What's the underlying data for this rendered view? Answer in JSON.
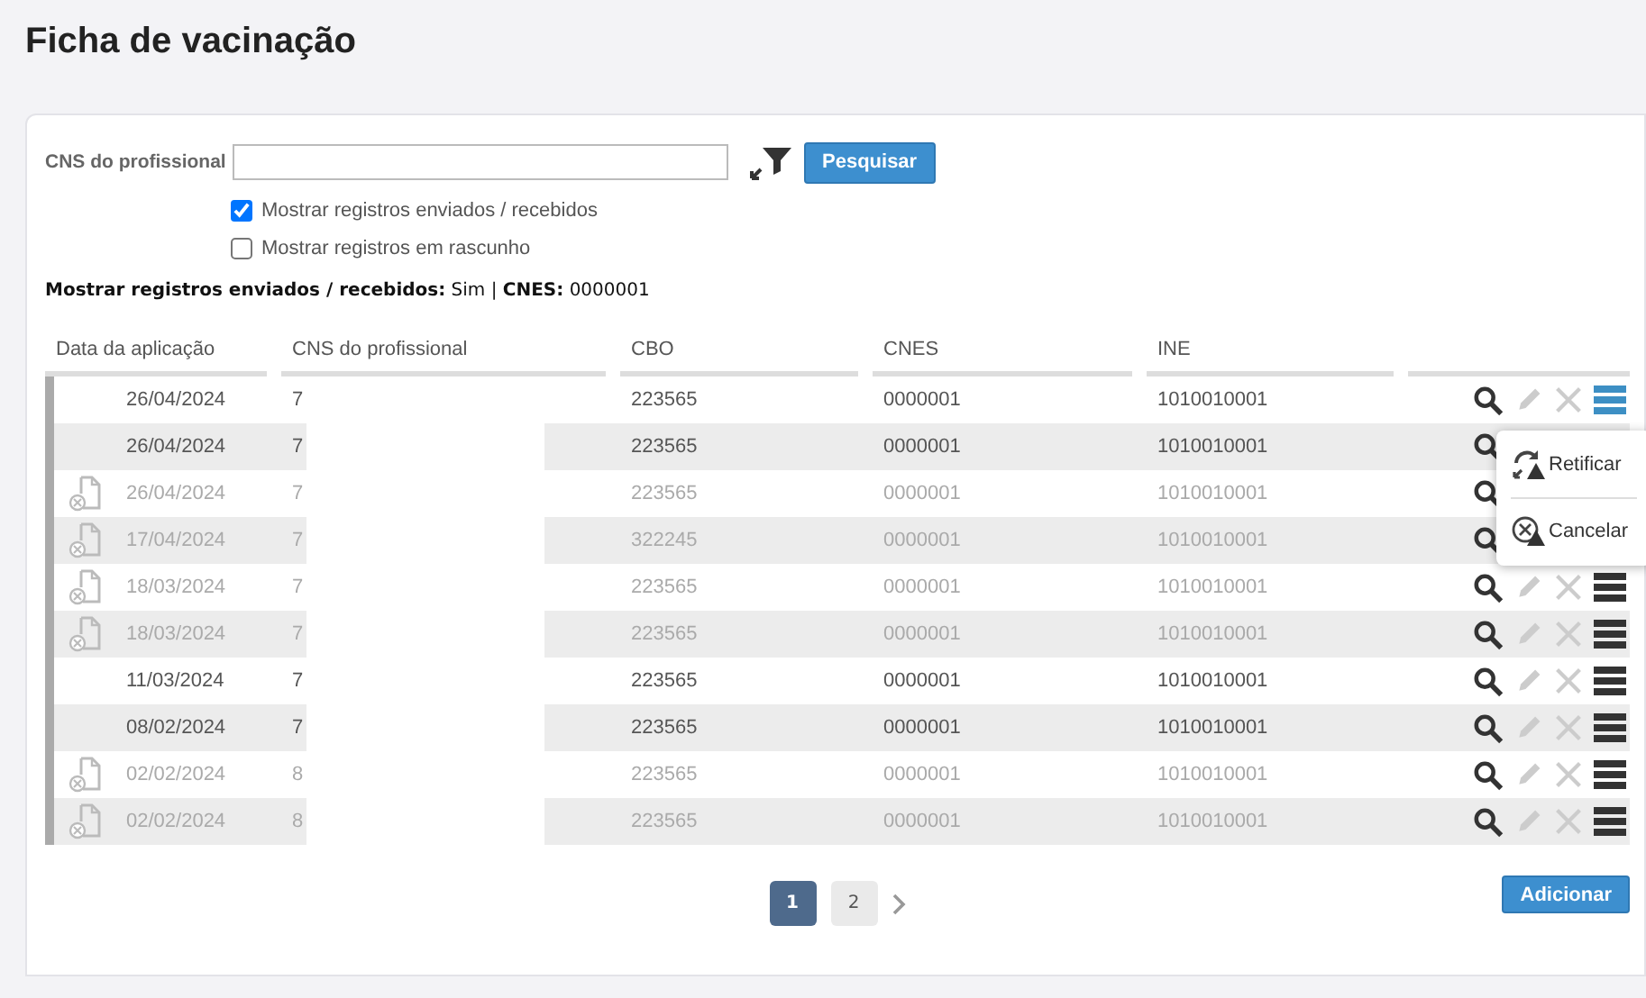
{
  "page_title": "Ficha de vacinação",
  "filter": {
    "label": "CNS do profissional",
    "button": "Pesquisar"
  },
  "options": [
    {
      "label": "Mostrar registros enviados / recebidos",
      "checked": true
    },
    {
      "label": "Mostrar registros em rascunho",
      "checked": false
    }
  ],
  "summary": "**Mostrar registros enviados / recebidos:** Sim | **CNES:** 0000001",
  "table": {
    "columns": [
      "Data da aplicação",
      "CNS do profissional",
      "CBO",
      "CNES",
      "INE"
    ],
    "rows": [
      {
        "date": "26/04/2024",
        "cns": "7",
        "cbo": "223565",
        "cnes": "0000001",
        "ine": "1010010001",
        "disabled": false,
        "menu_open": true
      },
      {
        "date": "26/04/2024",
        "cns": "7",
        "cbo": "223565",
        "cnes": "0000001",
        "ine": "1010010001",
        "disabled": false,
        "menu_open": false
      },
      {
        "date": "26/04/2024",
        "cns": "7",
        "cbo": "223565",
        "cnes": "0000001",
        "ine": "1010010001",
        "disabled": true,
        "menu_open": false
      },
      {
        "date": "17/04/2024",
        "cns": "7",
        "cbo": "322245",
        "cnes": "0000001",
        "ine": "1010010001",
        "disabled": true,
        "menu_open": false
      },
      {
        "date": "18/03/2024",
        "cns": "7",
        "cbo": "223565",
        "cnes": "0000001",
        "ine": "1010010001",
        "disabled": true,
        "menu_open": false
      },
      {
        "date": "18/03/2024",
        "cns": "7",
        "cbo": "223565",
        "cnes": "0000001",
        "ine": "1010010001",
        "disabled": true,
        "menu_open": false
      },
      {
        "date": "11/03/2024",
        "cns": "7",
        "cbo": "223565",
        "cnes": "0000001",
        "ine": "1010010001",
        "disabled": false,
        "menu_open": false
      },
      {
        "date": "08/02/2024",
        "cns": "7",
        "cbo": "223565",
        "cnes": "0000001",
        "ine": "1010010001",
        "disabled": false,
        "menu_open": false
      },
      {
        "date": "02/02/2024",
        "cns": "8",
        "cbo": "223565",
        "cnes": "0000001",
        "ine": "1010010001",
        "disabled": true,
        "menu_open": false
      },
      {
        "date": "02/02/2024",
        "cns": "8",
        "cbo": "223565",
        "cnes": "0000001",
        "ine": "1010010001",
        "disabled": true,
        "menu_open": false
      }
    ]
  },
  "row_menu": [
    {
      "kind": "rectify",
      "label": "Retificar"
    },
    {
      "kind": "cancel",
      "label": "Cancelar"
    }
  ],
  "pagination": [
    {
      "label": "1",
      "selected": true
    },
    {
      "label": "2",
      "selected": false
    }
  ],
  "add_button": "Adicionar"
}
